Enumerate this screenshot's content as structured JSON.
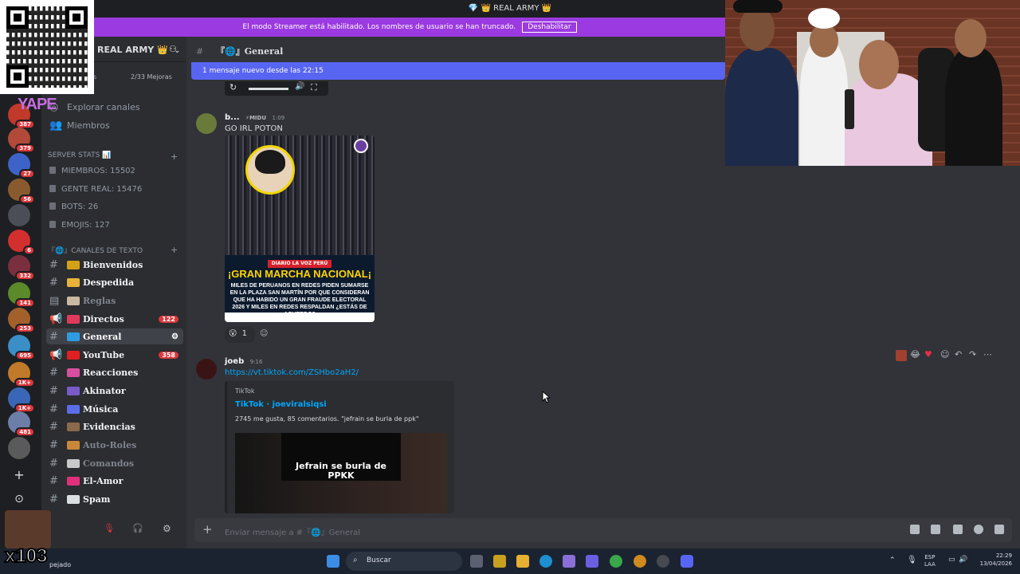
{
  "titlebar": {
    "title": "💎 👑 REAL ARMY 👑"
  },
  "banner": {
    "text": "El modo Streamer está habilitado. Los nombres de usuario se han truncado.",
    "button": "Deshabilitar"
  },
  "server": {
    "name": "REAL ARMY 👑",
    "boosts": "2/33 Mejoras",
    "boost_label": "oras"
  },
  "sidebar": {
    "top_items": [
      {
        "label": "Explorar canales"
      },
      {
        "label": "Miembros"
      }
    ],
    "stats_category": "SERVER STATS 📊",
    "stats": [
      "MIEMBROS: 15502",
      "GENTE REAL: 15476",
      "BOTS: 26",
      "EMOJIS: 127"
    ],
    "text_category": "『🌐』CANALES DE TEXTO",
    "channels": [
      {
        "label": "Bienvenidos",
        "type": "text",
        "style": "bold"
      },
      {
        "label": "Despedida",
        "type": "text",
        "style": "bold"
      },
      {
        "label": "Reglas",
        "type": "rules",
        "style": "dim"
      },
      {
        "label": "Directos",
        "type": "announce",
        "style": "bold",
        "badge": "122"
      },
      {
        "label": "General",
        "type": "text",
        "style": "sel"
      },
      {
        "label": "YouTube",
        "type": "announce",
        "style": "bold",
        "badge": "358"
      },
      {
        "label": "Reacciones",
        "type": "text",
        "style": "bold"
      },
      {
        "label": "Akinator",
        "type": "text",
        "style": "bold"
      },
      {
        "label": "Música",
        "type": "text",
        "style": "bold"
      },
      {
        "label": "Evidencias",
        "type": "text",
        "style": "bold"
      },
      {
        "label": "Auto-Roles",
        "type": "text",
        "style": "dim"
      },
      {
        "label": "Comandos",
        "type": "text",
        "style": "dim"
      },
      {
        "label": "El-Amor",
        "type": "text",
        "style": "bold"
      },
      {
        "label": "Spam",
        "type": "text",
        "style": "bold"
      }
    ]
  },
  "rail": {
    "badges": [
      "387",
      "379",
      "27",
      "56",
      "",
      "6",
      "332",
      "141",
      "253",
      "695",
      "1K+",
      "1K+",
      "481",
      ""
    ]
  },
  "channel": {
    "name": "『🌐』General",
    "new_messages": "1 mensaje nuevo desde las 22:15"
  },
  "messages": [
    {
      "author": "b...",
      "tag": "MIDU",
      "time": "1:09",
      "text": "GO IRL POTON",
      "image": {
        "label": "DIARIO LA VOZ PERÚ",
        "headline": "¡GRAN MARCHA NACIONAL¡",
        "subtext": "MILES DE PERUANOS EN REDES PIDEN SUMARSE EN LA PLAZA SAN MARTÍN POR QUE CONSIDERAN QUE HA HABIDO UN GRAN FRAUDE ELECTORAL 2026 Y MILES EN REDES RESPALDAN ¿ESTÁS DE ACUERDO?"
      },
      "reaction_count": "1"
    },
    {
      "author": "joeb",
      "time": "9:16",
      "link": "https://vt.tiktok.com/ZSHbo2aH2/",
      "embed": {
        "provider": "TikTok",
        "title": "TikTok · joeviralsiqsi",
        "description": "2745 me gusta, 85 comentarios. \"jefrain se burla de ppk\"",
        "thumb_caption": "Jefrain se burla de PPKK"
      }
    }
  ],
  "composer": {
    "placeholder": "Enviar mensaje a #『🌐』General"
  },
  "overlay": {
    "yape": "YAPE",
    "counter": "x103",
    "weather": "pejado"
  },
  "taskbar": {
    "search": "Buscar",
    "lang": "ESP",
    "layout": "LAA",
    "time": "22:29",
    "date": "13/04/2026"
  }
}
